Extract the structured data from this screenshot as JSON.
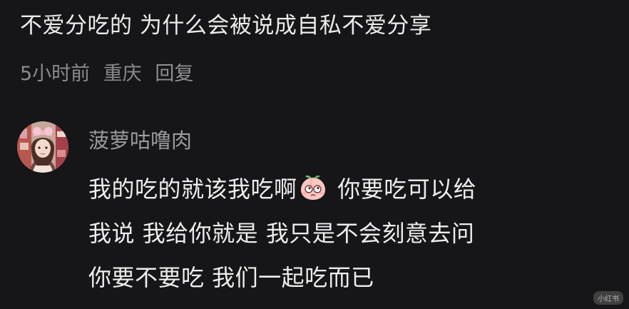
{
  "comment": {
    "text": "不爱分吃的 为什么会被说成自私不爱分享",
    "time": "5小时前",
    "location": "重庆",
    "reply_label": "回复"
  },
  "reply": {
    "username": "菠萝咕噜肉",
    "avatar_icon": "user-avatar-photo",
    "lines": [
      {
        "before": "我的吃的就该我吃啊",
        "emoji": "peach-eyes-emoji",
        "after": " 你要吃可以给"
      },
      {
        "text": "我说 我给你就是 我只是不会刻意去问"
      },
      {
        "text": "你要不要吃 我们一起吃而已"
      }
    ]
  },
  "watermark": "小红书",
  "colors": {
    "background": "#161618",
    "text": "#ececec",
    "muted": "#8a8a8e",
    "username": "#9a9aa0"
  }
}
